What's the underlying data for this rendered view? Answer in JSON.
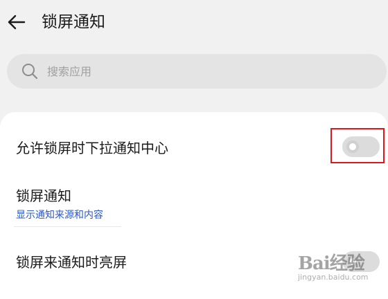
{
  "header": {
    "title": "锁屏通知",
    "back_icon": "back-arrow-icon"
  },
  "search": {
    "placeholder": "搜索应用",
    "value": "",
    "icon": "search-icon"
  },
  "settings": {
    "allow_pulldown": {
      "label": "允许锁屏时下拉通知中心",
      "enabled": false
    },
    "lockscreen_notifications": {
      "label": "锁屏通知",
      "value": "显示通知来源和内容"
    },
    "wake_on_notification": {
      "label": "锁屏来通知时亮屏",
      "enabled": false
    }
  },
  "watermark": {
    "brand": "Bai经验",
    "url": "jingyan.baidu.com"
  },
  "colors": {
    "background": "#f1f1f1",
    "card": "#ffffff",
    "link": "#2a57c4",
    "highlight": "#e0161b",
    "toggle_off": "#dcdcdc"
  }
}
